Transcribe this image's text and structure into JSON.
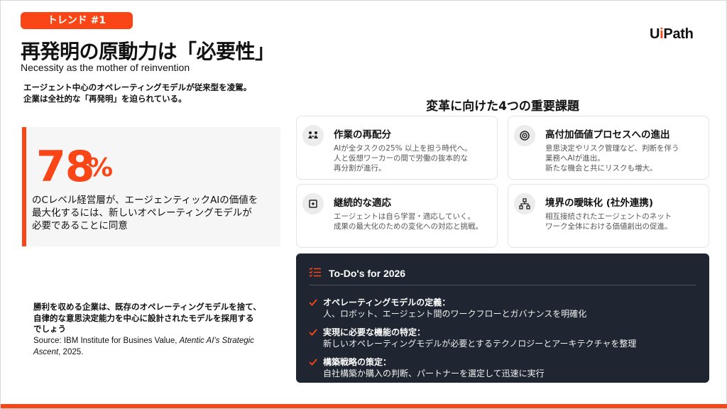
{
  "badge": "トレンド #1",
  "title": "再発明の原動力は「必要性」",
  "subtitle": "Necessity as the mother of reinvention",
  "logo": {
    "prefix": "U",
    "i": "i",
    "suffix": "Path"
  },
  "intro": [
    "エージェント中心のオペレーティングモデルが従来型を凌駕。",
    "企業は全社的な「再発明」を迫られている。"
  ],
  "stat": {
    "value": "78",
    "unit": "%",
    "lines": [
      "のCレベル経営層が、エージェンティックAIの価値を",
      "最大化するには、新しいオペレーティングモデルが",
      "必要であることに同意"
    ]
  },
  "quote": [
    "勝利を収める企業は、既存のオペレーティングモデルを捨て、",
    "自律的な意思決定能力を中心に設計されたモデルを採用する",
    "でしょう"
  ],
  "source": {
    "line1_prefix": "Source: IBM Institute for Busines Value, ",
    "line1_italic": "Atentic AI's Strategic",
    "line2_italic": "Ascent",
    "line2_suffix": ", 2025."
  },
  "section_title": "変革に向けた4つの重要課題",
  "cards": [
    {
      "title": "作業の再配分",
      "icon": "people-exchange-icon",
      "desc": [
        "AIが全タスクの25% 以上を担う時代へ。",
        "人と仮想ワーカーの間で労働の抜本的な",
        "再分割が進行。"
      ]
    },
    {
      "title": "高付加価値プロセスへの進出",
      "icon": "target-icon",
      "desc": [
        "意思決定やリスク管理など、判断を伴う",
        "業務へAIが進出。",
        "新たな機会と共にリスクも増大。"
      ]
    },
    {
      "title": "継続的な適応",
      "icon": "adapt-cycle-icon",
      "desc": [
        "エージェントは自ら学習・適応していく。",
        "成果の最大化のための変化への対応と挑戦。"
      ]
    },
    {
      "title": "境界の曖昧化 (社外連携)",
      "icon": "network-icon",
      "desc": [
        "相互接続されたエージェントのネット",
        "ワーク全体における価値創出の促進。"
      ]
    }
  ],
  "todo": {
    "title": "To-Do's for 2026",
    "items": [
      {
        "head": "オペレーティングモデルの定義：",
        "body": "人、ロボット、エージェント間のワークフローとガバナンスを明確化"
      },
      {
        "head": "実現に必要な機能の特定：",
        "body": "新しいオペレーティングモデルが必要とするテクノロジーとアーキテクチャを整理"
      },
      {
        "head": "構築戦略の策定：",
        "body": "自社構築か購入の判断、パートナーを選定して迅速に実行"
      }
    ]
  },
  "colors": {
    "accent": "#fa4616",
    "dark_panel": "#1f2631",
    "stat_bg": "#f6f6f6"
  }
}
